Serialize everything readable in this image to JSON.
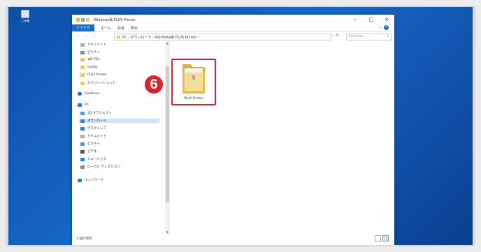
{
  "desktop": {
    "recycle_label": "ごみ箱"
  },
  "window": {
    "title": "Windows版 PLUS Printer",
    "controls": [
      "－",
      "□",
      "×"
    ]
  },
  "ribbon": {
    "file": "ファイル",
    "tabs": [
      "ホーム",
      "共有",
      "表示"
    ]
  },
  "address": {
    "nav": "← → ↑",
    "path": "PC › ダウンロード › Windows版 PLUS Printer ›",
    "search_placeholder": "Windows...",
    "search_icon": "magnifier-icon"
  },
  "sidebar": {
    "items": [
      {
        "label": "ドキュメント",
        "icon": "documents-icon",
        "color": "#9fb3c8"
      },
      {
        "label": "ピクチャ",
        "icon": "pictures-icon",
        "color": "#6b8fbf"
      },
      {
        "label": "★D-TEG",
        "icon": "folder-icon",
        "color": "#f2c84e"
      },
      {
        "label": "config",
        "icon": "folder-icon",
        "color": "#f2c84e"
      },
      {
        "label": "PLUS Printer",
        "icon": "folder-icon",
        "color": "#f2c84e"
      },
      {
        "label": "スクリーンショット",
        "icon": "folder-icon",
        "color": "#f2c84e"
      },
      {
        "label": "OneDrive",
        "icon": "onedrive-icon",
        "color": "#1a6dc2"
      },
      {
        "label": "PC",
        "icon": "pc-icon",
        "color": "#2f7fd4"
      },
      {
        "label": "3D オブジェクト",
        "icon": "3d-objects-icon",
        "color": "#4aa3e0"
      },
      {
        "label": "ダウンロード",
        "icon": "download-icon",
        "color": "#2f7fd4"
      },
      {
        "label": "デスクトップ",
        "icon": "desktop-icon",
        "color": "#2f7fd4"
      },
      {
        "label": "ドキュメント",
        "icon": "documents-icon",
        "color": "#9fb3c8"
      },
      {
        "label": "ピクチャ",
        "icon": "pictures-icon",
        "color": "#6b8fbf"
      },
      {
        "label": "ビデオ",
        "icon": "video-icon",
        "color": "#555555"
      },
      {
        "label": "ミュージック",
        "icon": "music-icon",
        "color": "#2f7fd4"
      },
      {
        "label": "ローカル ディスク (C:)",
        "icon": "drive-icon",
        "color": "#8c8c8c"
      },
      {
        "label": "ネットワーク",
        "icon": "network-icon",
        "color": "#2f7fd4"
      }
    ]
  },
  "content": {
    "folder_label": "PLUS Printer"
  },
  "status": {
    "count": "1 個の項目"
  },
  "annotation": {
    "step": "6",
    "color": "#d8242c"
  }
}
